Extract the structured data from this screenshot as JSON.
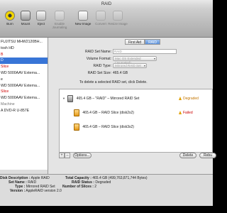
{
  "window": {
    "title": "RAID"
  },
  "toolbar": {
    "items": [
      {
        "label": "Burn",
        "icon": "burn-icon"
      },
      {
        "label": "Mount",
        "icon": "mount-icon"
      },
      {
        "label": "Eject",
        "icon": "eject-icon"
      },
      {
        "label": "Enable Journaling",
        "icon": "journal-icon"
      },
      {
        "label": "New Image",
        "icon": "new-image-icon"
      },
      {
        "label": "Convert",
        "icon": "convert-icon"
      },
      {
        "label": "Resize Image",
        "icon": "resize-icon"
      }
    ]
  },
  "sidebar": {
    "items": [
      {
        "label": "FUJITSU MHW2120BH...",
        "state": "normal"
      },
      {
        "label": "tosh HD",
        "state": "normal"
      },
      {
        "label": "B",
        "state": "red"
      },
      {
        "label": "D",
        "state": "selected"
      },
      {
        "label": "Slice",
        "state": "red"
      },
      {
        "label": "WD 5000AAV Externa...",
        "state": "normal"
      },
      {
        "label": "e",
        "state": "normal"
      },
      {
        "label": "WD 5000AAV Externa...",
        "state": "normal"
      },
      {
        "label": "Slice",
        "state": "red"
      },
      {
        "label": "WD 5000AAV Externa...",
        "state": "normal"
      },
      {
        "label": "Machine",
        "state": "gray"
      },
      {
        "label": "A DVD-R U-857E",
        "state": "normal"
      }
    ]
  },
  "tabs": [
    {
      "label": "First Aid",
      "active": false
    },
    {
      "label": "RAID",
      "active": true
    }
  ],
  "form": {
    "set_name_label": "RAID Set Name:",
    "set_name_value": "RAID",
    "volume_format_label": "Volume Format:",
    "volume_format_value": "Mac OS Extended (Journaled)",
    "raid_type_label": "RAID Type:",
    "raid_type_value": "Mirrored RAID Set",
    "raid_size_label": "RAID Set Size:",
    "raid_size_value": "465.4 GB",
    "help_text": "To delete a selected RAID set, click Delete."
  },
  "raid_list": [
    {
      "name": "465.4 GB – \"RAID\" – Mirrored RAID Set",
      "status": "Degraded",
      "kind": "set"
    },
    {
      "name": "465.4 GB – RAID Slice (disk2s2)",
      "status": "Failed",
      "kind": "disk"
    },
    {
      "name": "465.4 GB – RAID Slice (disk3s2)",
      "status": "",
      "kind": "disk"
    }
  ],
  "list_toolbar": {
    "add_label": "+",
    "remove_label": "–",
    "options_label": "Options...",
    "delete_label": "Delete",
    "rebuild_label": "Rebu"
  },
  "info": {
    "disk_desc_label": "Disk Description :",
    "disk_desc_value": "Apple RAID",
    "set_name_label": "Set Name :",
    "set_name_value": "RAID",
    "type_label": "Type :",
    "type_value": "Mirrored RAID Set",
    "version_label": "Version :",
    "version_value": "AppleRAID version 2.0",
    "capacity_label": "Total Capacity :",
    "capacity_value": "465.4 GB (499,763,871,744 Bytes)",
    "status_label": "RAID Status :",
    "status_value": "Degraded",
    "slices_label": "Number of Slices :",
    "slices_value": "2"
  },
  "colors": {
    "selection": "#3875d7",
    "failed": "#cc0000",
    "degraded": "#c47500"
  }
}
